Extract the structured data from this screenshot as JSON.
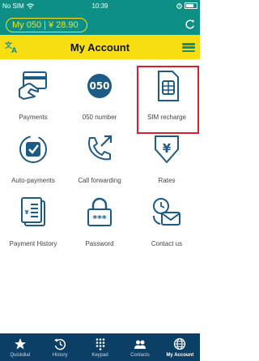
{
  "status": {
    "carrier": "No SIM",
    "time": "10:39"
  },
  "balance": {
    "label": "My 050",
    "amount": "¥ 28.90"
  },
  "header": {
    "title": "My Account",
    "lang_icon": "translate-icon",
    "menu_icon": "hamburger-menu-icon"
  },
  "colors": {
    "teal": "#0d8f86",
    "yellow": "#f7de12",
    "navy": "#0c3f66",
    "highlight": "#d6232b"
  },
  "grid": [
    {
      "label": "Payments",
      "icon": "card-payment-icon"
    },
    {
      "label": "050 number",
      "icon": "050-number-icon"
    },
    {
      "label": "SIM recharge",
      "icon": "sim-card-icon",
      "highlighted": true
    },
    {
      "label": "Auto-payments",
      "icon": "auto-payment-icon"
    },
    {
      "label": "Call forwarding",
      "icon": "call-forwarding-icon"
    },
    {
      "label": "Rates",
      "icon": "rates-icon"
    },
    {
      "label": "Payment History",
      "icon": "payment-history-icon"
    },
    {
      "label": "Password",
      "icon": "password-lock-icon"
    },
    {
      "label": "Contact us",
      "icon": "contact-us-icon"
    }
  ],
  "tabs": [
    {
      "label": "Quickdial",
      "icon": "star-icon"
    },
    {
      "label": "History",
      "icon": "history-icon"
    },
    {
      "label": "Keypad",
      "icon": "keypad-icon"
    },
    {
      "label": "Contacts",
      "icon": "contacts-icon"
    },
    {
      "label": "My Account",
      "icon": "globe-icon",
      "active": true
    }
  ]
}
